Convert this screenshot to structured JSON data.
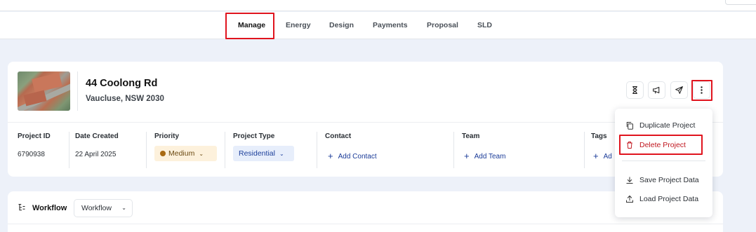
{
  "tabs": [
    "Manage",
    "Energy",
    "Design",
    "Payments",
    "Proposal",
    "SLD"
  ],
  "active_tab": "Manage",
  "project": {
    "address_line1": "44 Coolong Rd",
    "address_line2": "Vaucluse, NSW 2030"
  },
  "header_icons": [
    "hourglass-icon",
    "megaphone-icon",
    "send-icon",
    "more-vertical-icon"
  ],
  "meta": {
    "project_id_label": "Project ID",
    "project_id_value": "6790938",
    "date_created_label": "Date Created",
    "date_created_value": "22 April 2025",
    "priority_label": "Priority",
    "priority_value": "Medium",
    "project_type_label": "Project Type",
    "project_type_value": "Residential",
    "contact_label": "Contact",
    "contact_add": "Add Contact",
    "team_label": "Team",
    "team_add": "Add Team",
    "tags_label": "Tags",
    "tags_add": "Ad"
  },
  "menu": {
    "duplicate": "Duplicate Project",
    "delete": "Delete Project",
    "save": "Save Project Data",
    "load": "Load Project Data"
  },
  "workflow": {
    "label": "Workflow",
    "select_value": "Workflow"
  },
  "colors": {
    "highlight": "#e0141e",
    "link": "#1a3b98",
    "danger": "#c0151d",
    "background": "#edf1f9"
  }
}
